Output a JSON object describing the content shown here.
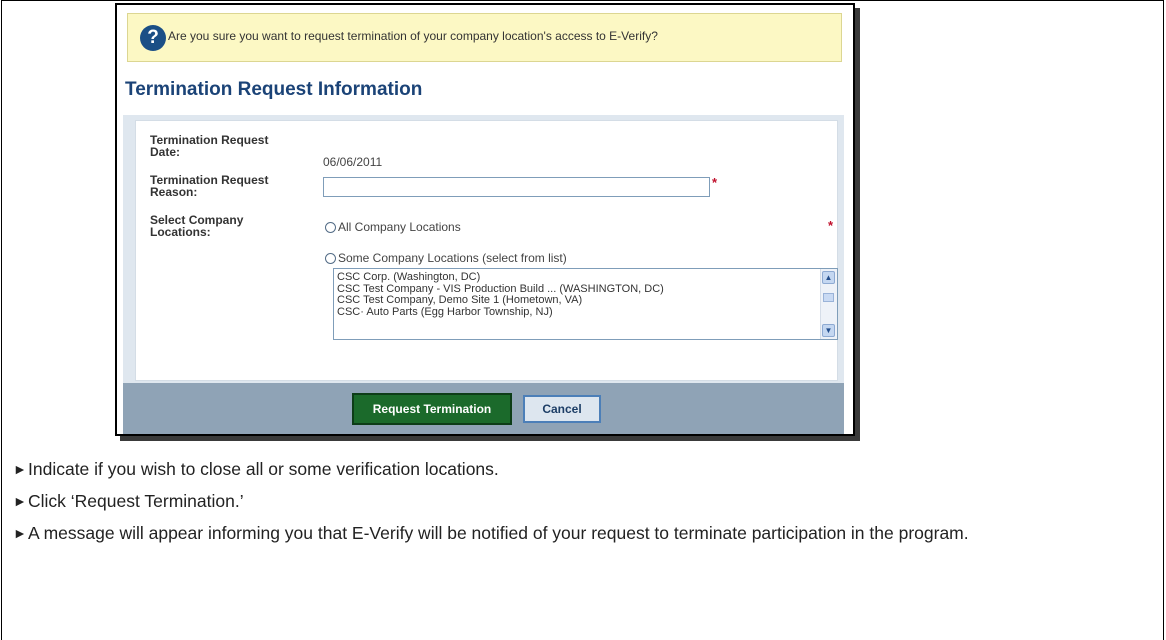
{
  "dialog": {
    "confirm_message": "Are you sure you want to request termination of your company location's access to E-Verify?",
    "help_icon_glyph": "?",
    "section_title": "Termination Request Information",
    "fields": {
      "date_label": "Termination Request Date:",
      "date_value": "06/06/2011",
      "reason_label": "Termination Request Reason:",
      "reason_value": "",
      "locations_label": "Select Company Locations:",
      "required_mark": "*"
    },
    "location_options": {
      "all": "All Company Locations",
      "some": "Some Company Locations (select from list)"
    },
    "location_list": [
      "CSC Corp. (Washington, DC)",
      "CSC Test Company - VIS Production Build ... (WASHINGTON, DC)",
      "CSC Test Company, Demo Site 1 (Hometown, VA)",
      "CSC·           Auto Parts (Egg Harbor Township, NJ)"
    ],
    "buttons": {
      "request": "Request Termination",
      "cancel": "Cancel"
    },
    "colors": {
      "title": "#1b4377",
      "request_button": "#1b6a2b",
      "required": "#c0102c",
      "confirm_bar": "#fcf8c4"
    }
  },
  "instructions": [
    "Indicate if you wish to close all or some verification locations.",
    "Click ‘Request Termination.’",
    "A message will appear informing you that E-Verify will be notified of your request to terminate participation in the program."
  ],
  "bullet_glyph": "►"
}
